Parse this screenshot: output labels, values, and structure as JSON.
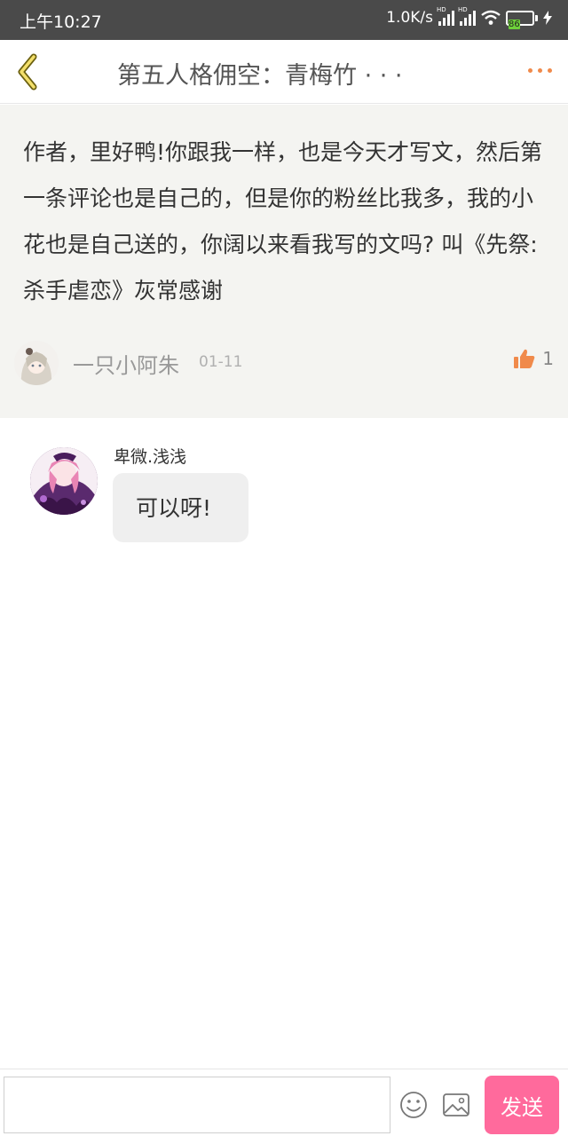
{
  "status_bar": {
    "time": "上午10:27",
    "net_speed": "1.0K/s",
    "battery": "86"
  },
  "header": {
    "title": "第五人格佣空：青梅竹 · · ·"
  },
  "comment": {
    "text": "作者，里好鸭!你跟我一样，也是今天才写文，然后第一条评论也是自己的，但是你的粉丝比我多，我的小花也是自己送的，你阔以来看我写的文吗? 叫《先祭:杀手虐恋》灰常感谢",
    "author": "一只小阿朱",
    "date": "01-11",
    "likes": "1"
  },
  "reply": {
    "author": "卑微.浅浅",
    "text": "可以呀!"
  },
  "input_bar": {
    "placeholder": "",
    "send_label": "发送"
  },
  "colors": {
    "accent_orange": "#f08a4b",
    "send_pink": "#ff6a9c",
    "comment_bg": "#f4f4f1"
  }
}
